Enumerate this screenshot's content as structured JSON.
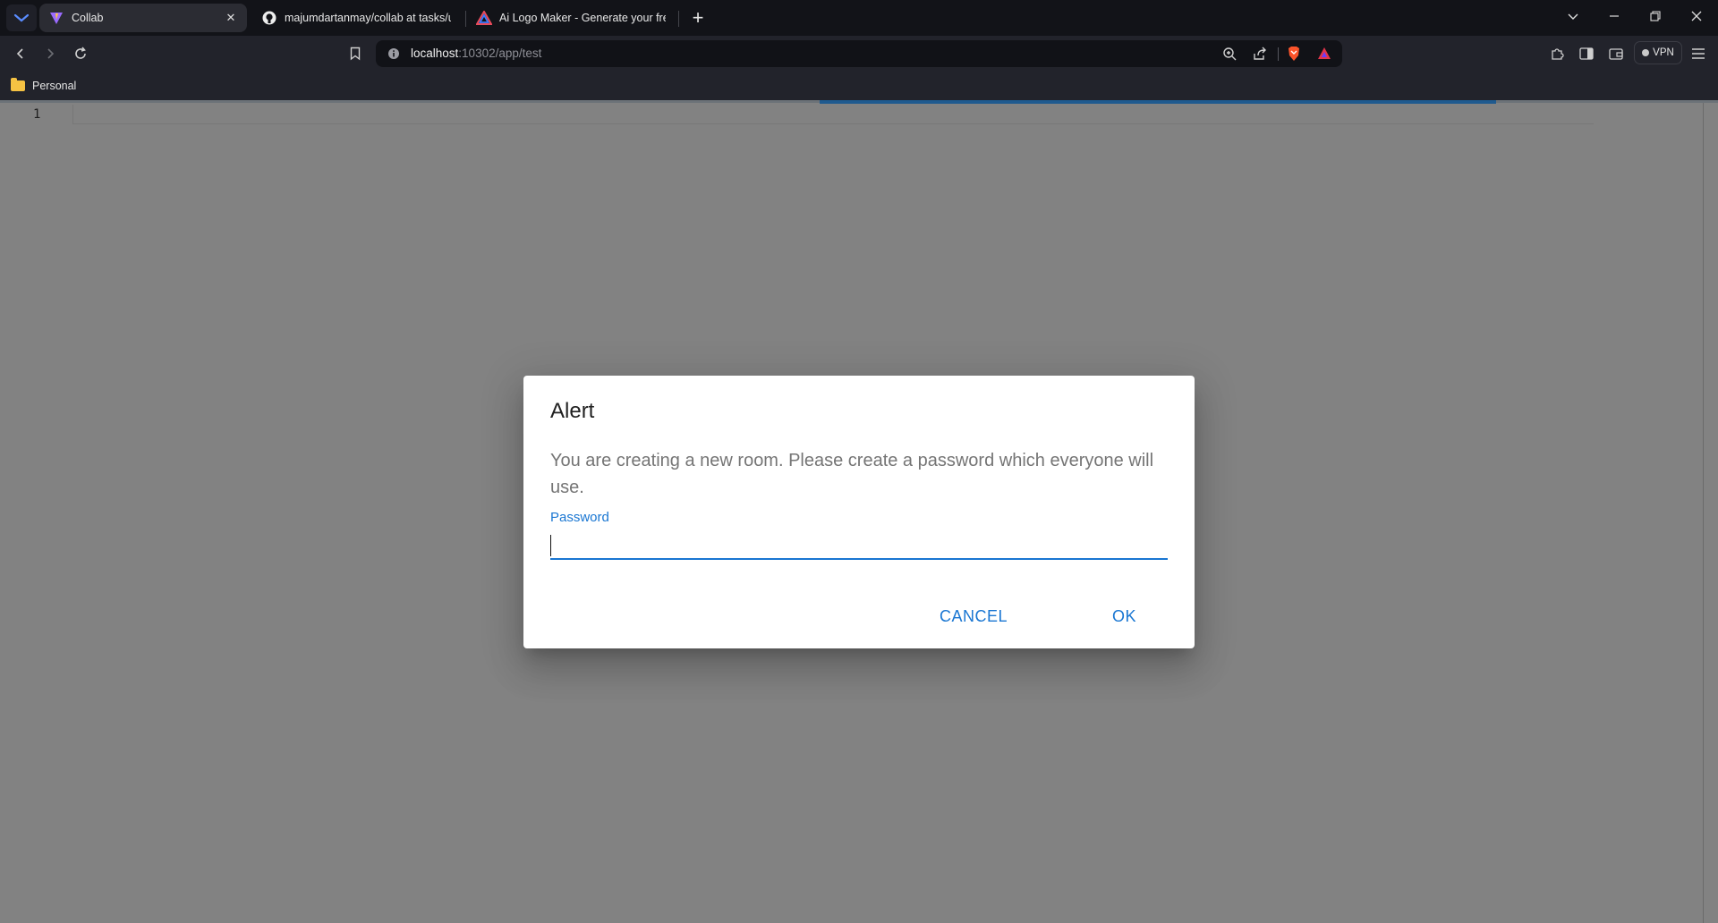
{
  "browser": {
    "tabs": [
      {
        "title": "Collab",
        "active": true,
        "icon": "vite-logo-icon"
      },
      {
        "title": "majumdartanmay/collab at tasks/up",
        "active": false,
        "icon": "github-icon"
      },
      {
        "title": "Ai Logo Maker - Generate your free",
        "active": false,
        "icon": "triangle-logo-icon"
      }
    ],
    "tab_close": "✕",
    "new_tab": "+",
    "address": {
      "host": "localhost",
      "path": ":10302/app/test"
    },
    "vpn_label": "VPN",
    "bookmarks": [
      {
        "label": "Personal",
        "icon": "folder-icon"
      }
    ]
  },
  "editor": {
    "line_numbers": [
      "1"
    ]
  },
  "dialog": {
    "title": "Alert",
    "message": "You are creating a new room. Please create a password which everyone will use.",
    "field_label": "Password",
    "field_value": "",
    "cancel_label": "CANCEL",
    "ok_label": "OK"
  },
  "colors": {
    "accent": "#1976d2",
    "overlay": "#828282",
    "chrome_dark": "#121318",
    "toolbar": "#22232b"
  }
}
